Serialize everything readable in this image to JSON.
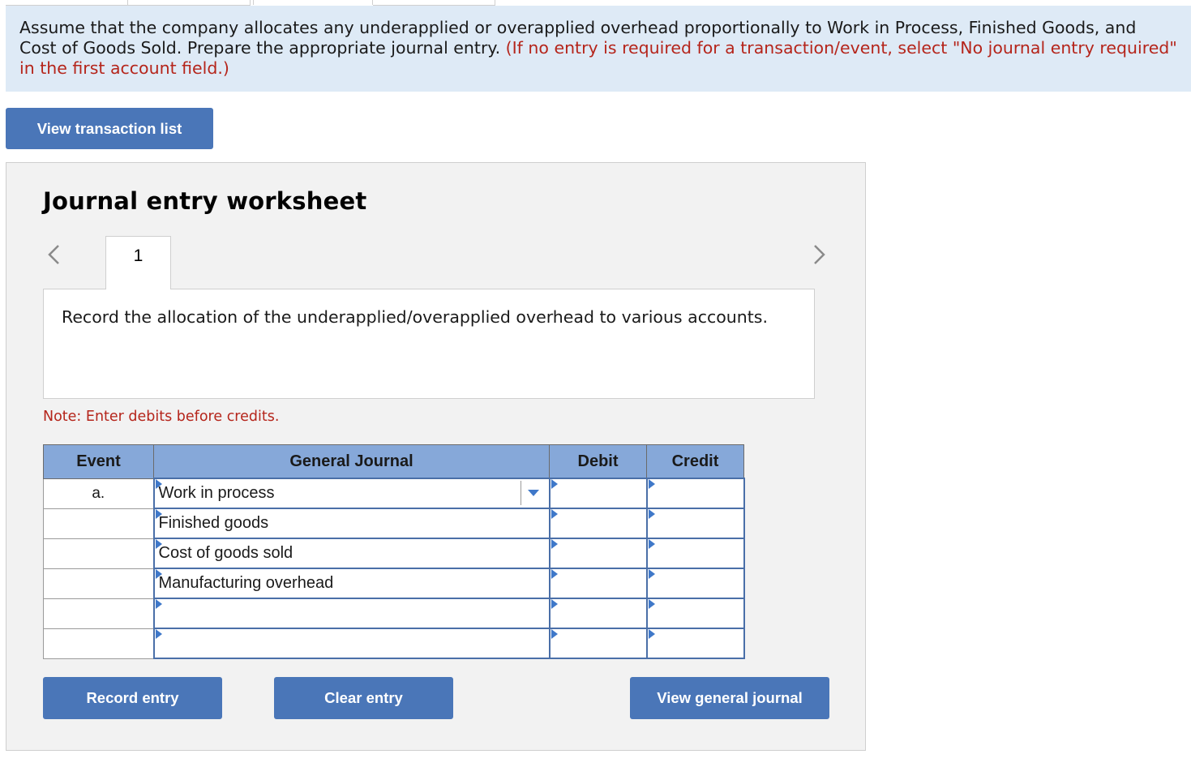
{
  "instructions": {
    "text": "Assume that the company allocates any underapplied or overapplied overhead proportionally to Work in Process, Finished Goods, and Cost of Goods Sold. Prepare the appropriate journal entry. ",
    "note_red": "(If no entry is required for a transaction/event, select \"No journal entry required\" in the first account field.)"
  },
  "buttons": {
    "view_transaction_list": "View transaction list",
    "record_entry": "Record entry",
    "clear_entry": "Clear entry",
    "view_general_journal": "View general journal"
  },
  "worksheet": {
    "title": "Journal entry worksheet",
    "current_step": "1",
    "description": "Record the allocation of the underapplied/overapplied overhead to various accounts.",
    "note": "Note: Enter debits before credits."
  },
  "journal": {
    "headers": [
      "Event",
      "General Journal",
      "Debit",
      "Credit"
    ],
    "rows": [
      {
        "event": "a.",
        "account": "Work in process",
        "debit": "",
        "credit": ""
      },
      {
        "event": "",
        "account": "Finished goods",
        "debit": "",
        "credit": ""
      },
      {
        "event": "",
        "account": "Cost of goods sold",
        "debit": "",
        "credit": ""
      },
      {
        "event": "",
        "account": "Manufacturing overhead",
        "debit": "",
        "credit": ""
      },
      {
        "event": "",
        "account": "",
        "debit": "",
        "credit": ""
      },
      {
        "event": "",
        "account": "",
        "debit": "",
        "credit": ""
      }
    ]
  }
}
